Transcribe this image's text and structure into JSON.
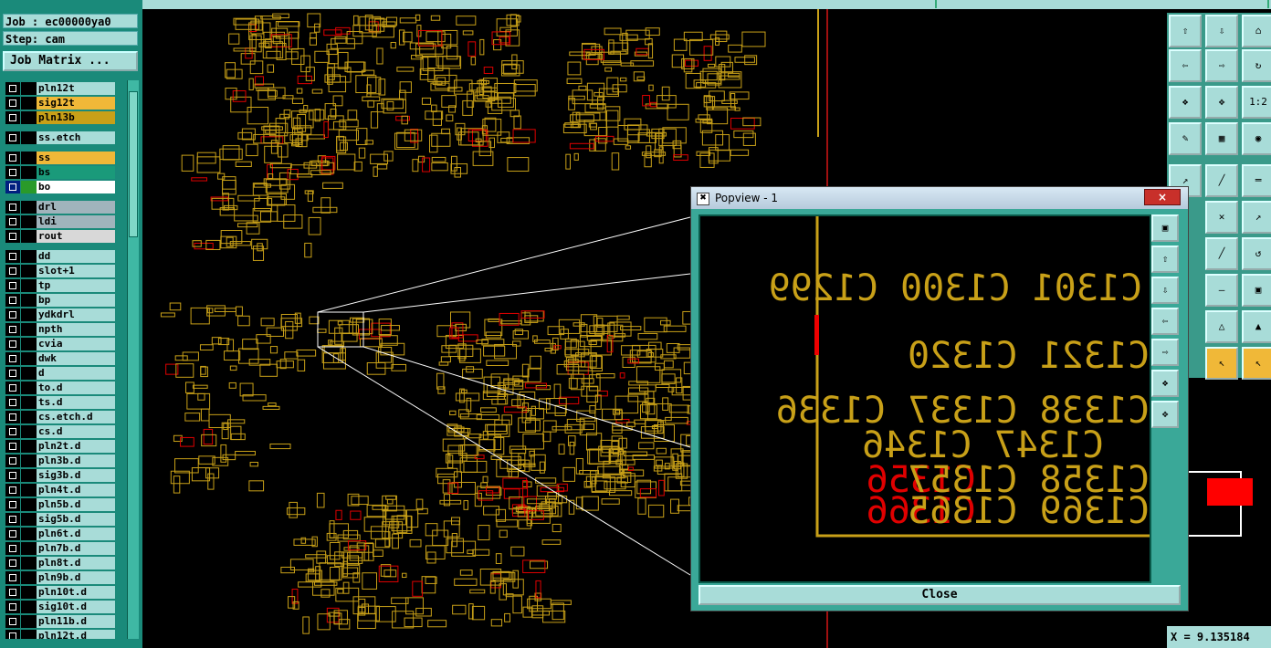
{
  "job_label": "Job : ec00000ya0",
  "step_label": "Step: cam",
  "job_matrix_label": "Job Matrix ...",
  "layers": [
    {
      "name": "pln12t",
      "color": "#a8dcd8"
    },
    {
      "name": "sig12t",
      "color": "#f0b838"
    },
    {
      "name": "pln13b",
      "color": "#c8a018"
    },
    {
      "name": "ss.etch",
      "color": "#a8dcd8"
    },
    {
      "name": "ss",
      "color": "#f0b838"
    },
    {
      "name": "bs",
      "color": "#1a9a7a"
    },
    {
      "name": "bo",
      "color": "#ffffff"
    },
    {
      "name": "drl",
      "color": "#a0b4bc"
    },
    {
      "name": "ldi",
      "color": "#a0b4bc"
    },
    {
      "name": "rout",
      "color": "#d8d8d8"
    },
    {
      "name": "dd",
      "color": "#a8dcd8"
    },
    {
      "name": "slot+1",
      "color": "#a8dcd8"
    },
    {
      "name": "tp",
      "color": "#a8dcd8"
    },
    {
      "name": "bp",
      "color": "#a8dcd8"
    },
    {
      "name": "ydkdrl",
      "color": "#a8dcd8"
    },
    {
      "name": "npth",
      "color": "#a8dcd8"
    },
    {
      "name": "cvia",
      "color": "#a8dcd8"
    },
    {
      "name": "dwk",
      "color": "#a8dcd8"
    },
    {
      "name": "d",
      "color": "#a8dcd8"
    },
    {
      "name": "to.d",
      "color": "#a8dcd8"
    },
    {
      "name": "ts.d",
      "color": "#a8dcd8"
    },
    {
      "name": "cs.etch.d",
      "color": "#a8dcd8"
    },
    {
      "name": "cs.d",
      "color": "#a8dcd8"
    },
    {
      "name": "pln2t.d",
      "color": "#a8dcd8"
    },
    {
      "name": "pln3b.d",
      "color": "#a8dcd8"
    },
    {
      "name": "sig3b.d",
      "color": "#a8dcd8"
    },
    {
      "name": "pln4t.d",
      "color": "#a8dcd8"
    },
    {
      "name": "pln5b.d",
      "color": "#a8dcd8"
    },
    {
      "name": "sig5b.d",
      "color": "#a8dcd8"
    },
    {
      "name": "pln6t.d",
      "color": "#a8dcd8"
    },
    {
      "name": "pln7b.d",
      "color": "#a8dcd8"
    },
    {
      "name": "pln8t.d",
      "color": "#a8dcd8"
    },
    {
      "name": "pln9b.d",
      "color": "#a8dcd8"
    },
    {
      "name": "pln10t.d",
      "color": "#a8dcd8"
    },
    {
      "name": "sig10t.d",
      "color": "#a8dcd8"
    },
    {
      "name": "pln11b.d",
      "color": "#a8dcd8"
    },
    {
      "name": "pln12t.d",
      "color": "#a8dcd8"
    }
  ],
  "popup": {
    "title": "Popview - 1",
    "close_label": "Close",
    "close_x": "×",
    "labels_line1": "C1301 C1300 C1299",
    "labels_line2": "C1321 C1320",
    "labels_line3": "C1338 C1337 C1336",
    "labels_line4": "C1347 C1346",
    "labels_line5a": "C1356",
    "labels_line5b": "C1358 C1357",
    "labels_line6a": "C1366",
    "labels_line6b": "C1369 C1365"
  },
  "coord_label": "X = 9.135184"
}
